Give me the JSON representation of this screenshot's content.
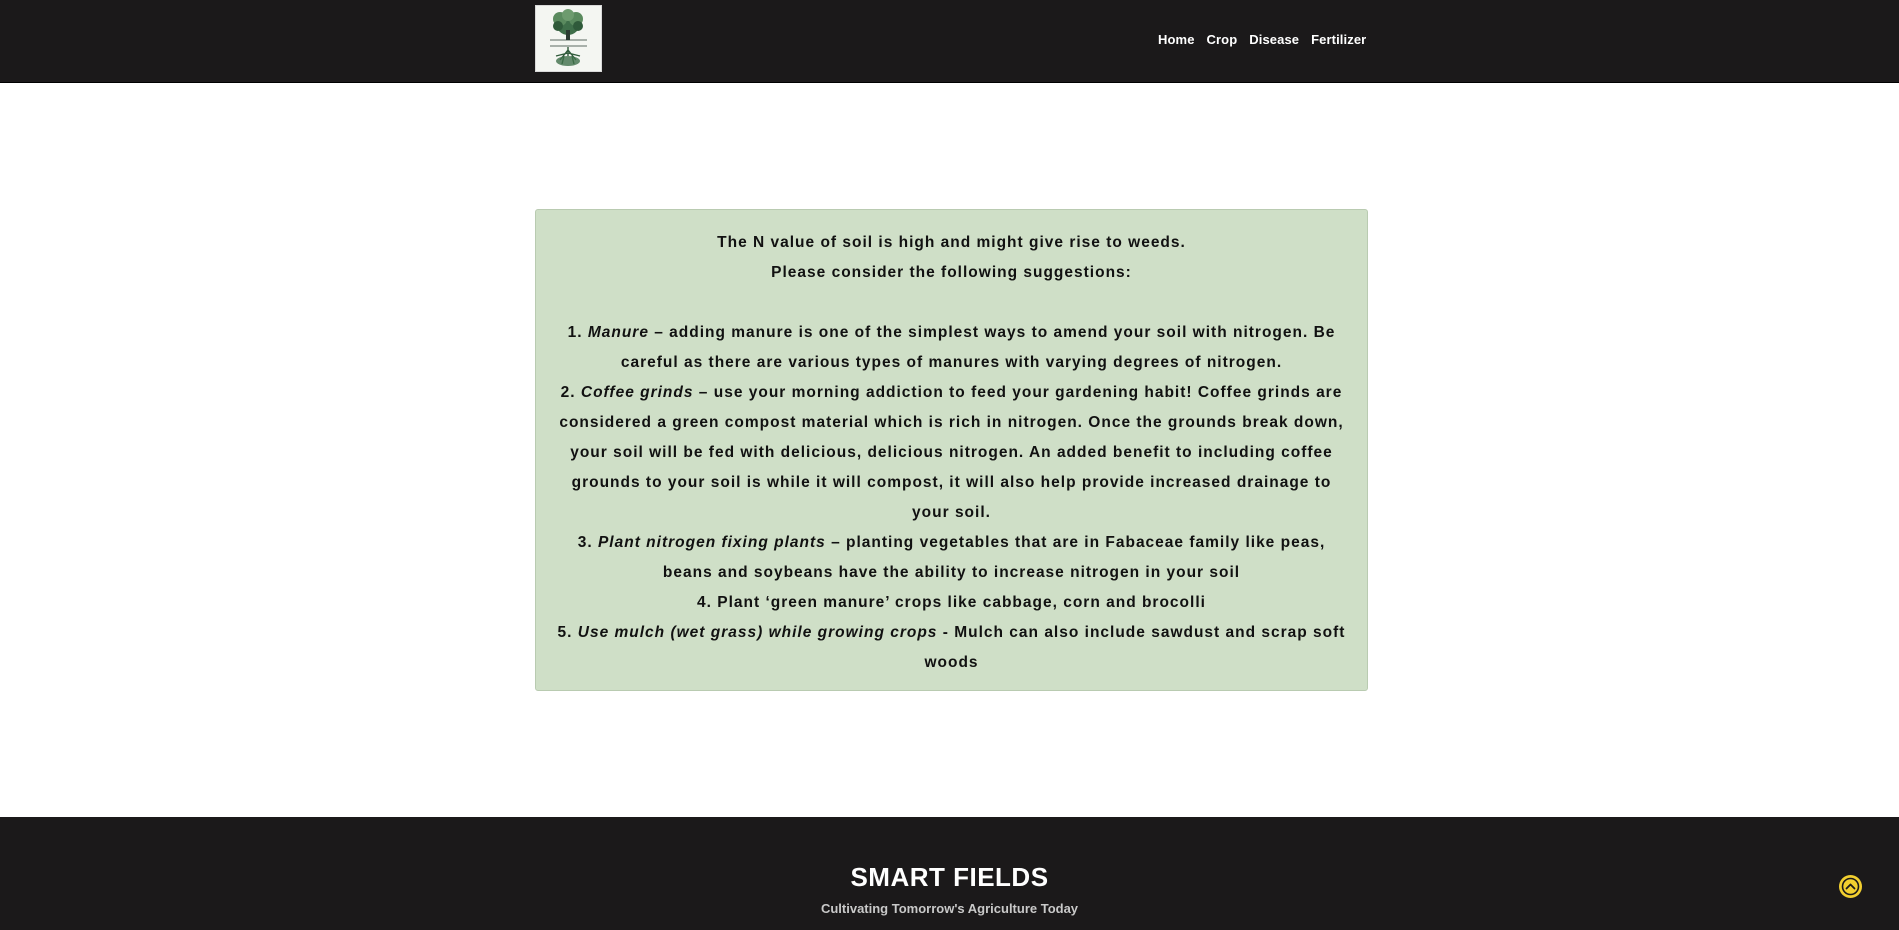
{
  "nav": {
    "logo_alt": "SMART FIELDS",
    "links": [
      "Home",
      "Crop",
      "Disease",
      "Fertilizer"
    ]
  },
  "result": {
    "intro_line1": "The N value of soil is high and might give rise to weeds.",
    "intro_line2": "Please consider the following suggestions:",
    "items": [
      {
        "num": "1. ",
        "title": "Manure",
        "sep": " – ",
        "text": "adding manure is one of the simplest ways to amend your soil with nitrogen. Be careful as there are various types of manures with varying degrees of nitrogen."
      },
      {
        "num": "2. ",
        "title": "Coffee grinds",
        "sep": " – ",
        "text": "use your morning addiction to feed your gardening habit! Coffee grinds are considered a green compost material which is rich in nitrogen. Once the grounds break down, your soil will be fed with delicious, delicious nitrogen. An added benefit to including coffee grounds to your soil is while it will compost, it will also help provide increased drainage to your soil."
      },
      {
        "num": "3. ",
        "title": "Plant nitrogen fixing plants",
        "sep": " – ",
        "text": "planting vegetables that are in Fabaceae family like peas, beans and soybeans have the ability to increase nitrogen in your soil"
      },
      {
        "num": "",
        "title": "",
        "sep": "",
        "text": "4. Plant ‘green manure’ crops like cabbage, corn and brocolli"
      },
      {
        "num": "5. ",
        "title": "Use mulch (wet grass) while growing crops",
        "sep": " - ",
        "text": "Mulch can also include sawdust and scrap soft woods"
      }
    ]
  },
  "footer": {
    "title": "SMART FIELDS",
    "tagline": "Cultivating Tomorrow's Agriculture Today"
  },
  "colors": {
    "nav_bg": "#1b191a",
    "result_bg": "#cfdfc7",
    "back_to_top": "#f2cf2f"
  },
  "icons": {
    "logo": "tree-logo-icon",
    "back_to_top": "chevron-up-icon"
  }
}
